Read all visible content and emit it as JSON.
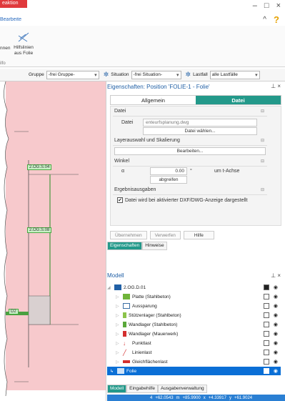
{
  "window": {
    "ribbon_tab": "Bearbeiten",
    "tab_partial": "eaktion",
    "minimize": "–",
    "maximize": "□",
    "close": "×",
    "collapse_ribbon": "^",
    "help": "?"
  },
  "ribbon": {
    "left_label": "nnen",
    "hilfslinien": "Hilfslinien aus Folie",
    "group": "ilfo"
  },
  "filterbar": {
    "gruppe_label": "Gruppe",
    "gruppe_value": "-frei Gruppe-",
    "situation_label": "Situation",
    "situation_value": "-frei Situation-",
    "lastfall_label": "Lastfall",
    "lastfall_value": "alle Lastfälle"
  },
  "properties": {
    "title": "Eigenschaften: Position 'FOLIE-1 - Folie'",
    "pin": "⊥ ×",
    "tabs": [
      "Allgemein",
      "Datei"
    ],
    "active_tab": "Datei",
    "datei_section": "Datei",
    "datei_label": "Datei",
    "datei_value": "enteurfsplanung.dwg",
    "datei_btn": "Datei wählen...",
    "layer_section": "Layerauswahl und Skalierung",
    "bearbeiten_btn": "Bearbeiten...",
    "winkel_section": "Winkel",
    "alpha_label": "α",
    "alpha_value": "0.00",
    "alpha_unit": "°",
    "axis_text": "um t-Achse",
    "abgreifen_btn": "abgreifen",
    "ergebnis_section": "Ergebnisausgaben",
    "checkbox_label": "Datei wird bei aktivierter DXF/DWG-Anzeige dargestellt",
    "buttons": [
      "Übernehmen",
      "Verwerfen",
      "Hilfe"
    ],
    "panel_tabs": [
      "Eigenschaften",
      "Hinweise"
    ]
  },
  "model": {
    "title": "Modell",
    "ctrl": "⊥ ×",
    "root": "2.OG.D.01",
    "items": [
      {
        "label": "Platte (Stahlbeton)",
        "color": "#6fb43a"
      },
      {
        "label": "Aussparung",
        "color": "#3b6ea5"
      },
      {
        "label": "Stützenlager (Stahlbeton)",
        "color": "#8bc34a"
      },
      {
        "label": "Wandlager (Stahlbeton)",
        "color": "#5aa83a"
      },
      {
        "label": "Wandlager (Mauerwerk)",
        "color": "#d32f2f"
      },
      {
        "label": "Punktlast",
        "color": "#d32f2f"
      },
      {
        "label": "Linienlast",
        "color": "#d32f2f"
      },
      {
        "label": "Gleichflächenlast",
        "color": "#d32f2f"
      }
    ],
    "selected_item": "Folie",
    "tabs": [
      "Modell",
      "Eingabehilfe",
      "Ausgabenverwaltung"
    ],
    "status": [
      "4",
      "+62.0543",
      "m",
      "+85.9900",
      "x",
      "+4.33917",
      "y",
      "+61.9024"
    ]
  },
  "canvas": {
    "labels": [
      "2.OG.S.04",
      "2.OG.S.08",
      "D2"
    ]
  }
}
